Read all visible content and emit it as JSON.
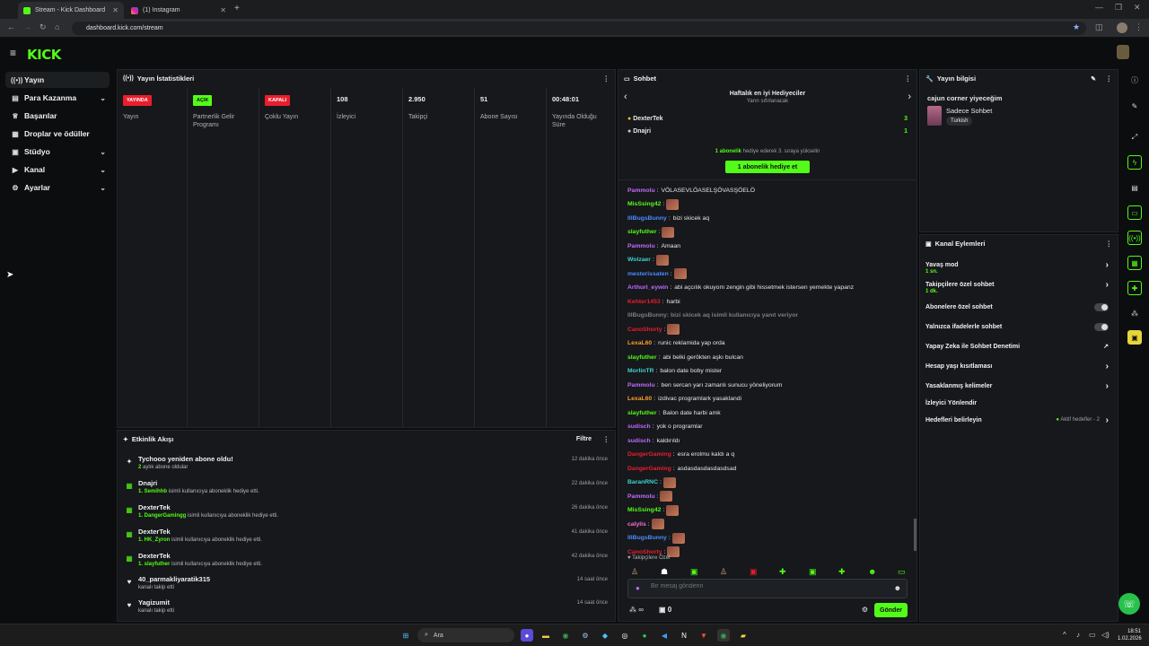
{
  "browser": {
    "tabs": [
      {
        "title": "Stream - Kick Dashboard",
        "close": "✕"
      },
      {
        "title": "(1) Instagram",
        "close": "✕"
      }
    ],
    "new_tab": "+",
    "url": "dashboard.kick.com/stream"
  },
  "logo": "KICK",
  "sidebar": {
    "items": [
      {
        "label": "Yayın",
        "icon": "broadcast-icon",
        "glyph": "((•))"
      },
      {
        "label": "Para Kazanma",
        "icon": "money-icon",
        "glyph": "▤",
        "chev": "⌄"
      },
      {
        "label": "Başarılar",
        "icon": "trophy-icon",
        "glyph": "♕"
      },
      {
        "label": "Droplar ve ödüller",
        "icon": "gift-icon",
        "glyph": "▦"
      },
      {
        "label": "Stüdyo",
        "icon": "studio-icon",
        "glyph": "▣",
        "chev": "⌄"
      },
      {
        "label": "Kanal",
        "icon": "channel-icon",
        "glyph": "▶",
        "chev": "⌄"
      },
      {
        "label": "Ayarlar",
        "icon": "gear-icon",
        "glyph": "⚙",
        "chev": "⌄"
      }
    ]
  },
  "stats": {
    "title": "Yayın İstatistikleri",
    "items": [
      {
        "value": "YAYINDA",
        "kind": "red",
        "label": "Yayın"
      },
      {
        "value": "AÇIK",
        "kind": "green",
        "label": "Partnerlik Gelir Programı"
      },
      {
        "value": "KAPALI",
        "kind": "red",
        "label": "Çoklu Yayın"
      },
      {
        "value": "108",
        "kind": "text",
        "label": "İzleyici"
      },
      {
        "value": "2.950",
        "kind": "text",
        "label": "Takipçi"
      },
      {
        "value": "51",
        "kind": "text",
        "label": "Abone Sayısı"
      },
      {
        "value": "00:48:01",
        "kind": "text",
        "label": "Yayında Olduğu Süre"
      }
    ]
  },
  "events": {
    "title": "Etkinlik Akışı",
    "filter": "Filtre",
    "rows": [
      {
        "title": "Tychooo yeniden abone oldu!",
        "hl": "2",
        "sub": " aylık abone oldular",
        "time": "12 dakika önce",
        "icon": "star-icon"
      },
      {
        "title": "Dnajri",
        "hl": "1. Semihhb",
        "sub": " isimli kullanıcıya aboneklik hediye etti.",
        "time": "22 dakika önce",
        "icon": "gift-icon"
      },
      {
        "title": "DexterTek",
        "hl": "1. DangerGamingg",
        "sub": " isimli kullanıcıya aboneklik hediye etti.",
        "time": "26 dakika önce",
        "icon": "gift-icon"
      },
      {
        "title": "DexterTek",
        "hl": "1. HK_Zyron",
        "sub": " isimli kullanıcıya aboneklik hediye etti.",
        "time": "41 dakika önce",
        "icon": "gift-icon"
      },
      {
        "title": "DexterTek",
        "hl": "1. slayfuther",
        "sub": " isimli kullanıcıya aboneklik hediye etti.",
        "time": "42 dakika önce",
        "icon": "gift-icon"
      },
      {
        "title": "40_parmakliyaratik315",
        "hl": "",
        "sub": "kanalı takip etti",
        "time": "14 saat önce",
        "icon": "heart-icon"
      },
      {
        "title": "Yagizumit",
        "hl": "",
        "sub": "kanalı takip etti",
        "time": "14 saat önce",
        "icon": "heart-icon"
      }
    ]
  },
  "chat": {
    "title": "Sohbet",
    "top_title": "Haftalık en iyi Hediyeciler",
    "top_sub": "Yarın sıfırlanacak",
    "gifters": [
      {
        "name": "DexterTek",
        "count": "3"
      },
      {
        "name": "Dnajri",
        "count": "1"
      }
    ],
    "promo_hl": "1 abonelik",
    "promo": " hediye ederek 3. sıraya yükselin",
    "gift_button": "1 abonelik hediye et",
    "messages": [
      {
        "user": "Pammolu",
        "color": "#c06bff",
        "text": "VÖLASEVLÖASELŞÖVASŞÖELÖ",
        "emote": false
      },
      {
        "user": "MisSsing42",
        "color": "#53fc18",
        "text": "",
        "emote": true
      },
      {
        "user": "IllBugsBunny",
        "color": "#4a8cff",
        "text": "bizi skicek aq",
        "emote": false
      },
      {
        "user": "slayfuther",
        "color": "#53fc18",
        "text": "",
        "emote": true
      },
      {
        "user": "Pammolu",
        "color": "#c06bff",
        "text": "Amaan",
        "emote": false
      },
      {
        "user": "Wolzaer",
        "color": "#3fd1d1",
        "text": "",
        "emote": true
      },
      {
        "user": "mesterissaten",
        "color": "#4a8cff",
        "text": "",
        "emote": true
      },
      {
        "user": "Arthurl_eywin",
        "color": "#c06bff",
        "text": "abi açcılık okuyom zengin gibi hissetmek istersen yemekte yapanz",
        "emote": false
      },
      {
        "user": "Kehter1453",
        "color": "#e91e2d",
        "text": "harbi",
        "emote": false
      },
      {
        "user": "IllBugsBunny: bizi skicek aq isimli kullanıcıya yanıt veriyor",
        "color": "#7a7f85",
        "text": "",
        "emote": false
      },
      {
        "user": "CanoShorty",
        "color": "#e91e2d",
        "text": "",
        "emote": true
      },
      {
        "user": "LexaL60",
        "color": "#ff9b2e",
        "text": "runic reklamida yap orda",
        "emote": false
      },
      {
        "user": "slayfuther",
        "color": "#53fc18",
        "text": "abi belki gerökten aşkı bulcan",
        "emote": false
      },
      {
        "user": "MorlinTR",
        "color": "#3fd1d1",
        "text": "balon date boby mister",
        "emote": false
      },
      {
        "user": "Pammolu",
        "color": "#c06bff",
        "text": "ben sercan yarı zamanlı sunucu yöneliyorum",
        "emote": false
      },
      {
        "user": "LexaL60",
        "color": "#ff9b2e",
        "text": "izdivac programlark yasaklandi",
        "emote": false
      },
      {
        "user": "slayfuther",
        "color": "#53fc18",
        "text": "Balon date harbi amk",
        "emote": false
      },
      {
        "user": "sudisch",
        "color": "#c06bff",
        "text": "yok o programlar",
        "emote": false
      },
      {
        "user": "sudisch",
        "color": "#c06bff",
        "text": "kaldırıldı",
        "emote": false
      },
      {
        "user": "DangerGaming",
        "color": "#e91e2d",
        "text": "esra erolmu kaldı a q",
        "emote": false
      },
      {
        "user": "DangerGaming",
        "color": "#e91e2d",
        "text": "asdasdasdasdasdsad",
        "emote": false
      },
      {
        "user": "BaranRNC",
        "color": "#3fd1d1",
        "text": "",
        "emote": true
      },
      {
        "user": "Pammolu",
        "color": "#c06bff",
        "text": "",
        "emote": true
      },
      {
        "user": "MisSsing42",
        "color": "#53fc18",
        "text": "",
        "emote": true
      },
      {
        "user": "calylis",
        "color": "#ff6bd5",
        "text": "",
        "emote": true
      },
      {
        "user": "IllBugsBunny",
        "color": "#4a8cff",
        "text": "",
        "emote": true
      },
      {
        "user": "CanoShorty",
        "color": "#e91e2d",
        "text": "",
        "emote": true
      }
    ],
    "followers_only": "Takipçilere Özel",
    "placeholder": "Bir mesaj gönderin",
    "points": "∞",
    "gifts": "0",
    "send": "Gönder"
  },
  "stream_info": {
    "title": "Yayın bilgisi",
    "stream_title": "cajun corner yiyeceğim",
    "category": "Sadece Sohbet",
    "tag": "Turkish"
  },
  "actions": {
    "title": "Kanal Eylemleri",
    "rows": [
      {
        "label": "Yavaş mod",
        "sub": "1 sn.",
        "type": "arrow"
      },
      {
        "label": "Takipçilere özel sohbet",
        "sub": "1 dk.",
        "type": "arrow"
      },
      {
        "label": "Abonelere özel sohbet",
        "sub": "",
        "type": "toggle"
      },
      {
        "label": "Yalnızca ifadelerle sohbet",
        "sub": "",
        "type": "toggle"
      },
      {
        "label": "Yapay Zeka ile Sohbet Denetimi",
        "sub": "",
        "type": "ext"
      },
      {
        "label": "Hesap yaşı kısıtlaması",
        "sub": "",
        "type": "arrow"
      },
      {
        "label": "Yasaklanmış kelimeler",
        "sub": "",
        "type": "arrow"
      },
      {
        "label": "İzleyici Yönlendir",
        "sub": "",
        "type": "none"
      },
      {
        "label": "Hedefleri belirleyin",
        "sub": "",
        "type": "goal"
      }
    ],
    "goal_status": "Aktif hedefler - 2"
  },
  "taskbar": {
    "search": "Ara",
    "time": "18:51",
    "date": "1.02.2026"
  },
  "colors": {
    "accent": "#53fc18",
    "live": "#e91e2d",
    "bg": "#0b0d0e",
    "panel": "#16181b"
  }
}
